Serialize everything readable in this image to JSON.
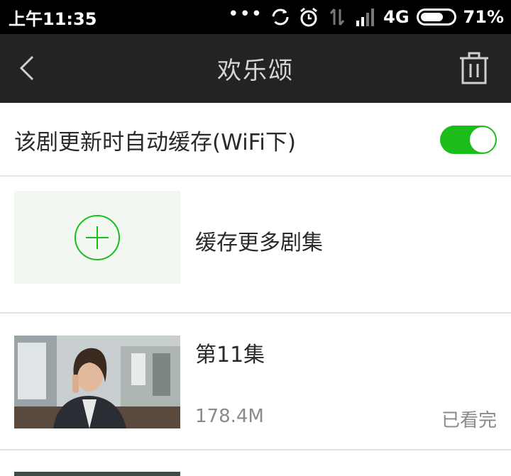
{
  "status_bar": {
    "time": "上午11:35",
    "dots": "•••",
    "network": "4G",
    "battery_percent": "71%",
    "battery_level": 0.71,
    "icons": [
      "sync-icon",
      "alarm-icon",
      "data-arrows-icon",
      "signal-icon"
    ]
  },
  "header": {
    "title": "欢乐颂",
    "back_icon": "chevron-left-icon",
    "delete_icon": "trash-icon"
  },
  "auto_cache": {
    "label": "该剧更新时自动缓存(WiFi下)",
    "enabled": true,
    "accent_color": "#1bbd1b"
  },
  "cache_more": {
    "label": "缓存更多剧集",
    "icon": "plus-circle-icon"
  },
  "episodes": [
    {
      "title": "第11集",
      "size": "178.4M",
      "status": "已看完"
    }
  ],
  "colors": {
    "header_bg": "#232323",
    "status_bg": "#000000",
    "accent": "#1bbd1b"
  }
}
